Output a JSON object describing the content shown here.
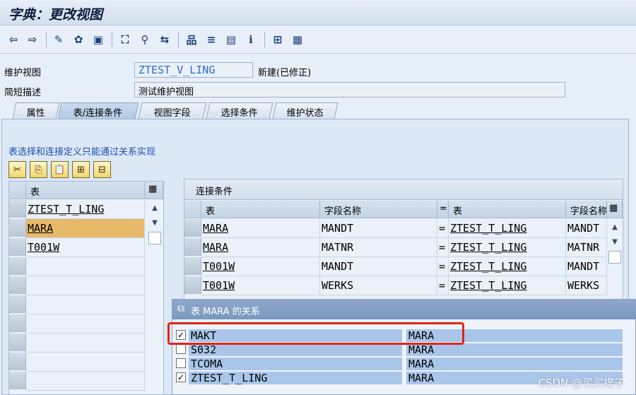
{
  "window": {
    "title": "字典：更改视图"
  },
  "form": {
    "view_label": "维护视图",
    "view_value": "ZTEST_V_LING",
    "view_status": "新建(已修正)",
    "desc_label": "简短描述",
    "desc_value": "测试维护视图"
  },
  "tabs": [
    "属性",
    "表/连接条件",
    "视图字段",
    "选择条件",
    "维护状态"
  ],
  "active_tab": "表/连接条件",
  "note": "表选择和连接定义只能通过关系实现",
  "icons": [
    "cut-icon",
    "copy-icon",
    "paste-icon",
    "insert-row-icon",
    "delete-row-icon"
  ],
  "tables": {
    "header": "表",
    "rows": [
      "ZTEST_T_LING",
      "MARA",
      "T001W"
    ],
    "selected_row": "MARA"
  },
  "join": {
    "title": "连接条件",
    "headers": [
      "表",
      "字段名称",
      "=",
      "表",
      "字段名称"
    ],
    "rows": [
      [
        "MARA",
        "MANDT",
        "=",
        "ZTEST_T_LING",
        "MANDT"
      ],
      [
        "MARA",
        "MATNR",
        "=",
        "ZTEST_T_LING",
        "MATNR"
      ],
      [
        "T001W",
        "MANDT",
        "=",
        "ZTEST_T_LING",
        "MANDT"
      ],
      [
        "T001W",
        "WERKS",
        "=",
        "ZTEST_T_LING",
        "WERKS"
      ]
    ]
  },
  "popup": {
    "title": "表 MARA 的关系",
    "rows": [
      {
        "checked": true,
        "name": "MAKT",
        "ref": "MARA"
      },
      {
        "checked": false,
        "name": "S032",
        "ref": "MARA"
      },
      {
        "checked": false,
        "name": "TCOMA",
        "ref": "MARA"
      },
      {
        "checked": true,
        "name": "ZTEST_T_LING",
        "ref": "MARA"
      }
    ]
  },
  "watermark": "CSDN @买买提子",
  "colors": {
    "highlight": "#e3241b",
    "selected_row": "#e8b96a",
    "popup_bar": "#a9c6ea"
  }
}
